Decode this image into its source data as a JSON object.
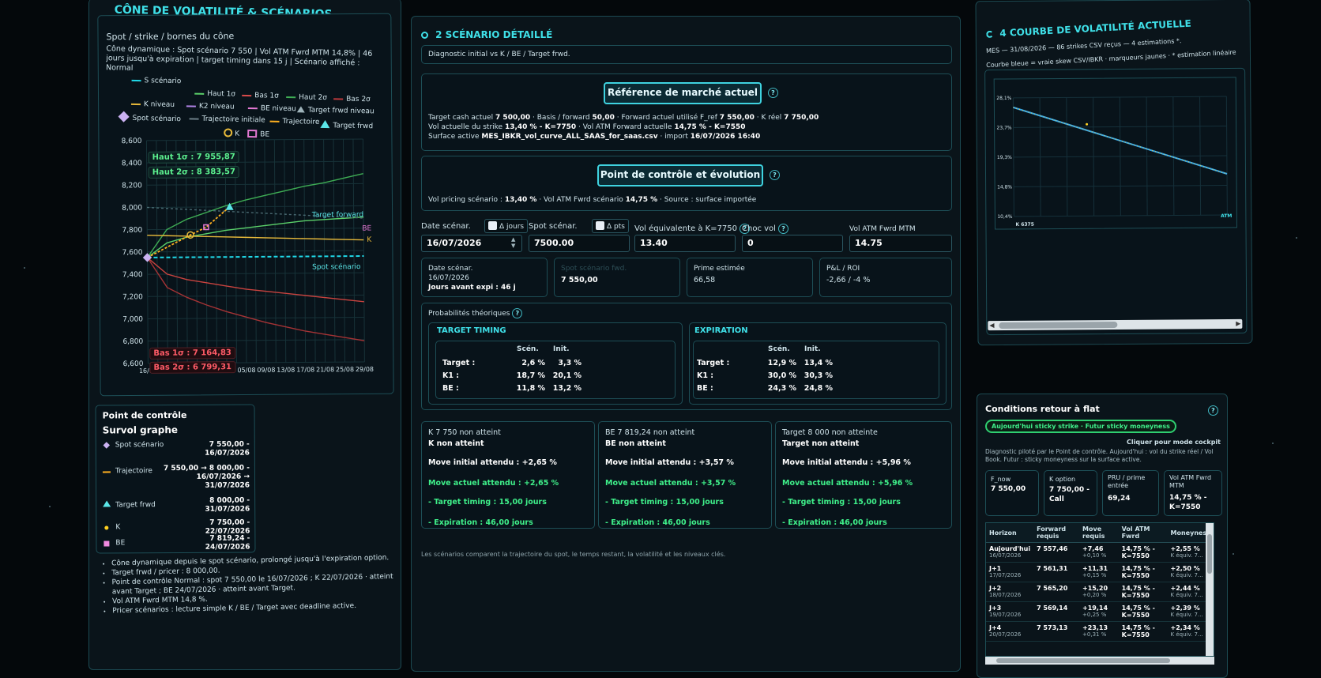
{
  "panel_cone": {
    "title": "CÔNE DE VOLATILITÉ & SCÉNARIOS",
    "subtitle": "Spot / strike / bornes du cône",
    "desc": "Cône dynamique : Spot scénario 7 550 | Vol ATM Fwrd MTM 14,8% | 46 jours jusqu'à expiration | target timing dans 15 j | Scénario affiché : Normal",
    "legend": [
      "S scénario",
      "Haut 1σ",
      "Bas 1σ",
      "Haut 2σ",
      "Bas 2σ",
      "K niveau",
      "K2 niveau",
      "BE niveau",
      "Target frwd niveau",
      "Spot scénario",
      "Trajectoire initiale",
      "Trajectoire",
      "Target frwd",
      "K",
      "BE"
    ],
    "tag_haut1": "Haut 1σ : 7 955,87",
    "tag_haut2": "Haut 2σ : 8 383,57",
    "tag_bas1": "Bas 1σ : 7 164,83",
    "tag_bas2": "Bas 2σ : 6 799,31",
    "label_target_forward": "Target forward",
    "label_spot_scenario": "Spot scénario",
    "label_be": "BE",
    "label_k": "K"
  },
  "chart_data": {
    "type": "line",
    "title": "",
    "xlabel": "",
    "ylabel": "",
    "x": [
      "16/07",
      "20/07",
      "24/07",
      "28/07",
      "01/08",
      "05/08",
      "09/08",
      "13/08",
      "17/08",
      "21/08",
      "25/08",
      "29/08"
    ],
    "y_ticks": [
      "8,600",
      "8,400",
      "8,200",
      "8,000",
      "7,800",
      "7,600",
      "7,400",
      "7,200",
      "7,000",
      "6,800",
      "6,600"
    ],
    "ylim": [
      6600,
      8600
    ],
    "series": [
      {
        "name": "Haut 2σ",
        "values": [
          7550,
          7800,
          7890,
          7950,
          8010,
          8060,
          8100,
          8140,
          8180,
          8210,
          8250,
          8290
        ]
      },
      {
        "name": "Haut 1σ",
        "values": [
          7550,
          7680,
          7730,
          7760,
          7790,
          7810,
          7830,
          7850,
          7870,
          7880,
          7890,
          7900
        ]
      },
      {
        "name": "Bas 1σ",
        "values": [
          7550,
          7400,
          7350,
          7320,
          7290,
          7260,
          7240,
          7220,
          7200,
          7180,
          7160,
          7140
        ]
      },
      {
        "name": "Bas 2σ",
        "values": [
          7550,
          7280,
          7190,
          7120,
          7060,
          7010,
          6960,
          6920,
          6880,
          6850,
          6820,
          6790
        ]
      },
      {
        "name": "K niveau",
        "values": [
          7750,
          7745,
          7740,
          7735,
          7730,
          7725,
          7720,
          7715,
          7710,
          7705,
          7700,
          7695
        ]
      },
      {
        "name": "S scénario",
        "values": [
          7550,
          7550,
          7550,
          7550,
          7550,
          7550,
          7550,
          7550,
          7550,
          7550,
          7550,
          7550
        ]
      },
      {
        "name": "Target frwd niveau",
        "values": [
          8000,
          7990,
          7980,
          7970,
          7960,
          7950,
          7940,
          7930,
          7920,
          7910,
          7900,
          7890
        ]
      }
    ],
    "trajectory": [
      [
        0,
        7550
      ],
      [
        2.2,
        7750
      ],
      [
        3.0,
        7819
      ],
      [
        4.2,
        8000
      ]
    ]
  },
  "control_point": {
    "title": "Point de contrôle",
    "subtitle": "Survol graphe",
    "rows": [
      {
        "label": "Spot scénario",
        "value": "7 550,00 -\n16/07/2026"
      },
      {
        "label": "Trajectoire",
        "value": "7 550,00 → 8 000,00 -\n16/07/2026 →\n31/07/2026"
      },
      {
        "label": "Target frwd",
        "value": "8 000,00 -\n31/07/2026"
      },
      {
        "label": "K",
        "value": "7 750,00 -\n22/07/2026"
      },
      {
        "label": "BE",
        "value": "7 819,24 -\n24/07/2026"
      }
    ]
  },
  "notes": [
    "Cône dynamique depuis le spot scénario, prolongé jusqu'à l'expiration option.",
    "Target frwd / pricer : 8 000,00.",
    "Point de contrôle Normal : spot 7 550,00 le 16/07/2026 ; K 22/07/2026 · atteint avant Target ; BE 24/07/2026 · atteint avant Target.",
    "Vol ATM Fwrd MTM 14,8 %.",
    "Pricer scénarios : lecture simple K / BE / Target avec deadline active."
  ],
  "scenario": {
    "title": "2 SCÉNARIO DÉTAILLÉ",
    "diag": "Diagnostic initial vs K / BE / Target frwd.",
    "ref_button": "Référence de marché actuel",
    "ref_line1_a": "Target cash actuel ",
    "ref_line1_b": "7 500,00",
    "ref_line1_c": " · Basis / forward ",
    "ref_line1_d": "50,00",
    "ref_line1_e": " · Forward actuel utilisé F_ref ",
    "ref_line1_f": "7 550,00",
    "ref_line1_g": " · K réel ",
    "ref_line1_h": "7 750,00",
    "ref_line2_a": "Vol actuelle du strike ",
    "ref_line2_b": "13,40 % - K=7750",
    "ref_line2_c": " · Vol ATM Forward actuelle ",
    "ref_line2_d": "14,75 % - K=7550",
    "ref_line3_a": "Surface active ",
    "ref_line3_b": "MES_IBKR_vol_curve_ALL_SAAS_for_saas.csv",
    "ref_line3_c": " · import ",
    "ref_line3_d": "16/07/2026 16:40",
    "ctrl_button": "Point de contrôle et évolution",
    "ctrl_line_a": "Vol pricing scénario : ",
    "ctrl_line_b": "13,40 %",
    "ctrl_line_c": " · Vol ATM Fwrd scénario ",
    "ctrl_line_d": "14,75 %",
    "ctrl_line_e": " · Source : surface importée",
    "fields": {
      "date_label": "Date scénar.",
      "date_delta": "Δ jours",
      "date_value": "16/07/2026",
      "spot_label": "Spot scénar.",
      "spot_delta": "Δ pts",
      "spot_value": "7500.00",
      "vol_label": "Vol équivalente à K=7750",
      "vol_value": "13.40",
      "choc_label": "Choc vol",
      "choc_value": "0",
      "atm_label": "Vol ATM Fwrd MTM",
      "atm_value": "14.75"
    },
    "cards": {
      "date_title": "Date scénar.",
      "date_value": "16/07/2026",
      "date_sub": "Jours avant expi : 46 j",
      "spot_title": "Spot scénario fwd.",
      "spot_value": "7 550,00",
      "prime_title": "Prime estimée",
      "prime_value": "66,58",
      "pnl_title": "P&L / ROI",
      "pnl_value": "-2,66 / -4 %"
    },
    "prob_title": "Probabilités théoriques",
    "timing": {
      "title": "TARGET TIMING",
      "col1": "Scén.",
      "col2": "Init.",
      "rows": [
        {
          "label": "Target :",
          "a": "2,6 %",
          "b": "3,3 %"
        },
        {
          "label": "K1 :",
          "a": "18,7 %",
          "b": "20,1 %"
        },
        {
          "label": "BE :",
          "a": "11,8 %",
          "b": "13,2 %"
        }
      ]
    },
    "expiration": {
      "title": "EXPIRATION",
      "col1": "Scén.",
      "col2": "Init.",
      "rows": [
        {
          "label": "Target :",
          "a": "12,9 %",
          "b": "13,4 %"
        },
        {
          "label": "K1 :",
          "a": "30,0 %",
          "b": "30,3 %"
        },
        {
          "label": "BE :",
          "a": "24,3 %",
          "b": "24,8 %"
        }
      ]
    },
    "status": [
      {
        "head": "K 7 750 non atteint",
        "sub": "K non atteint",
        "move_init": "Move initial attendu : +2,65 %",
        "move_now": "Move actuel attendu : +2,65 %",
        "timing": "- Target timing : 15,00 jours",
        "expi": "- Expiration : 46,00 jours"
      },
      {
        "head": "BE 7 819,24 non atteint",
        "sub": "BE non atteint",
        "move_init": "Move initial attendu : +3,57 %",
        "move_now": "Move actuel attendu : +3,57 %",
        "timing": "- Target timing : 15,00 jours",
        "expi": "- Expiration : 46,00 jours"
      },
      {
        "head": "Target 8 000 non atteinte",
        "sub": "Target non atteint",
        "move_init": "Move initial attendu : +5,96 %",
        "move_now": "Move actuel attendu : +5,96 %",
        "timing": "- Target timing : 15,00 jours",
        "expi": "- Expiration : 46,00 jours"
      }
    ],
    "footer": "Les scénarios comparent la trajectoire du spot, le temps restant, la volatilité et les niveaux clés."
  },
  "vol_curve": {
    "title": "4 COURBE DE VOLATILITÉ ACTUELLE",
    "line1": "MES — 31/08/2026 — 86 strikes CSV reçus — 4 estimations *.",
    "line2": "Courbe bleue = vraie skew CSV/IBKR · marqueurs jaunes · * estimation linéaire",
    "y_ticks": [
      "28,1%",
      "23,7%",
      "19,3%",
      "14,8%",
      "10,4%"
    ],
    "x_left": "K 6375",
    "x_right": "ATM"
  },
  "flat": {
    "title": "Conditions retour à flat",
    "badge": "Aujourd'hui sticky strike · Futur sticky moneyness",
    "cockpit": "Cliquer pour mode cockpit",
    "desc": "Diagnostic piloté par le Point de contrôle. Aujourd'hui : vol du strike réel / Vol Book. Futur : sticky moneyness sur la surface active.",
    "cards": [
      {
        "title": "F_now",
        "value": "7 550,00"
      },
      {
        "title": "K option",
        "value": "7 750,00 - Call"
      },
      {
        "title": "PRU / prime entrée",
        "value": "69,24"
      },
      {
        "title": "Vol ATM Fwrd MTM",
        "value": "14,75 % - K=7550"
      }
    ],
    "headers": [
      "Horizon",
      "Forward requis",
      "Move requis",
      "Vol ATM Fwrd",
      "Moneyness"
    ],
    "rows": [
      {
        "h": "Aujourd'hui",
        "d": "16/07/2026",
        "f": "7 557,46",
        "m": "+7,46",
        "mp": "+0,10 %",
        "v": "14,75 % - K=7550",
        "mo": "+2,55 %",
        "mos": "K équiv. 7..."
      },
      {
        "h": "J+1",
        "d": "17/07/2026",
        "f": "7 561,31",
        "m": "+11,31",
        "mp": "+0,15 %",
        "v": "14,75 % - K=7550",
        "mo": "+2,50 %",
        "mos": "K équiv. 7..."
      },
      {
        "h": "J+2",
        "d": "18/07/2026",
        "f": "7 565,20",
        "m": "+15,20",
        "mp": "+0,20 %",
        "v": "14,75 % - K=7550",
        "mo": "+2,44 %",
        "mos": "K équiv. 7..."
      },
      {
        "h": "J+3",
        "d": "19/07/2026",
        "f": "7 569,14",
        "m": "+19,14",
        "mp": "+0,25 %",
        "v": "14,75 % - K=7550",
        "mo": "+2,39 %",
        "mos": "K équiv. 7..."
      },
      {
        "h": "J+4",
        "d": "20/07/2026",
        "f": "7 573,13",
        "m": "+23,13",
        "mp": "+0,31 %",
        "v": "14,75 % - K=7550",
        "mo": "+2,34 %",
        "mos": "K équiv. 7..."
      }
    ]
  }
}
